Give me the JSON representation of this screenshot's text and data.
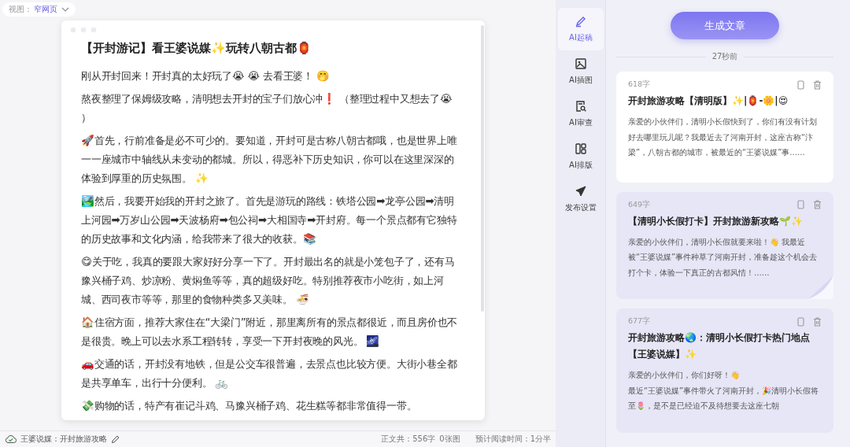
{
  "view_selector": {
    "label": "视图：",
    "value": "窄网页"
  },
  "editor": {
    "title": "【开封游记】看王婆说媒✨玩转八朝古都🏮",
    "paragraphs": [
      "刚从开封回来！开封真的太好玩了😭 😭 去看王婆！ 🤭",
      "熬夜整理了保姆级攻略，清明想去开封的宝子们放心冲❗ （整理过程中又想去了😭 ）",
      "🚀首先，行前准备是必不可少的。要知道，开封可是古称八朝古都哦，也是世界上唯一一座城市中轴线从未变动的都城。所以，得恶补下历史知识，你可以在这里深深的体验到厚重的历史氛围。 ✨",
      "🏞️然后，我要开始我的开封之旅了。首先是游玩的路线：铁塔公园➡龙亭公园➡清明上河园➡万岁山公园➡天波杨府➡包公祠➡大相国寺➡开封府。每一个景点都有它独特的历史故事和文化内涵，给我带来了很大的收获。📚",
      "😋关于吃，我真的要跟大家好好分享一下了。开封最出名的就是小笼包子了，还有马豫兴桶子鸡、炒凉粉、黄焖鱼等等，真的超级好吃。特别推荐夜市小吃街，如上河城、西司夜市等等，那里的食物种类多又美味。 🍜",
      "🏠住宿方面，推荐大家住在“大梁门”附近，那里离所有的景点都很近，而且房价也不是很贵。晚上可以去水系工程转转，享受一下开封夜晚的风光。 🌌",
      "🚗交通的话，开封没有地铁，但是公交车很普遍，去景点也比较方便。大街小巷全都是共享单车，出行十分便利。 🚲",
      "💸购物的话，特产有崔记斗鸡、马豫兴桶子鸡、花生糕等都非常值得一带。"
    ]
  },
  "status_bar": {
    "doc_name": "王婆说媒：开封旅游攻略",
    "word_count": "正文共：556字",
    "image_count": "0张图",
    "read_time": "预计阅读时间：1分半"
  },
  "nav": {
    "items": [
      {
        "kind": "pen",
        "label": "AI起稿",
        "selected": true
      },
      {
        "kind": "image",
        "label": "AI插图",
        "selected": false
      },
      {
        "kind": "review",
        "label": "AI审查",
        "selected": false
      },
      {
        "kind": "layout",
        "label": "AI排版",
        "selected": false
      },
      {
        "kind": "send",
        "label": "发布设置",
        "selected": false
      }
    ]
  },
  "generate_button": "生成文章",
  "timestamp": "27秒前",
  "articles": [
    {
      "count": "618字",
      "title": "开封旅游攻略【清明版】✨|🏮-🌼|😍",
      "excerpt": "亲爱的小伙伴们，清明小长假快到了，你们有没有计划好去哪里玩儿呢？我最近去了河南开封，这座古称“汴梁”，八朝古都的城市，被最近的“王婆说媒”事……",
      "selected": true,
      "curled": false
    },
    {
      "count": "649字",
      "title": "【清明小长假打卡】开封旅游新攻略🌱✨",
      "excerpt": "亲爱的小伙伴们，清明小长假就要来啦！👋 我最近被“王婆说媒”事件种草了河南开封，准备趁这个机会去打个卡，体验一下真正的古都风情！……",
      "selected": false,
      "curled": true
    },
    {
      "count": "677字",
      "title": "开封旅游攻略🌏：清明小长假打卡热门地点【王婆说媒】✨",
      "excerpt": "亲爱的小伙伴们，你们好呀！👋\n最近“王婆说媒”事件带火了河南开封，🎉清明小长假将至🌷，是不是已经迫不及待想要去这座七朝",
      "selected": false,
      "curled": false
    }
  ]
}
